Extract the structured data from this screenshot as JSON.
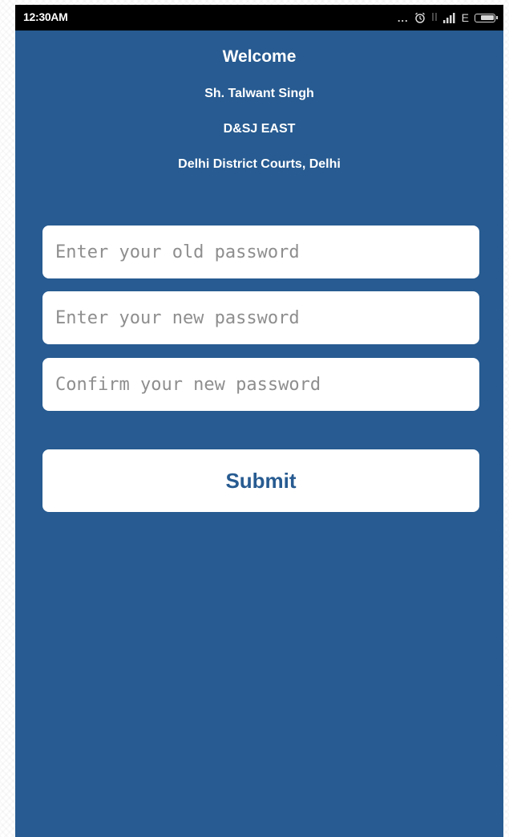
{
  "status_bar": {
    "time": "12:30AM",
    "dots": "...",
    "network_type": "E",
    "battery_level": 0.75
  },
  "header": {
    "welcome": "Welcome",
    "name": "Sh. Talwant Singh",
    "designation": "D&SJ EAST",
    "court": "Delhi District Courts, Delhi"
  },
  "form": {
    "old_password": {
      "value": "",
      "placeholder": "Enter your old password"
    },
    "new_password": {
      "value": "",
      "placeholder": "Enter your new password"
    },
    "confirm_password": {
      "value": "",
      "placeholder": "Confirm your new password"
    },
    "submit_label": "Submit"
  },
  "colors": {
    "background": "#275b91",
    "status_bar": "#000000",
    "field_background": "#ffffff",
    "submit_text": "#275b91"
  },
  "icons": {
    "alarm": "alarm-icon",
    "signal": "signal-icon",
    "battery": "battery-icon"
  }
}
